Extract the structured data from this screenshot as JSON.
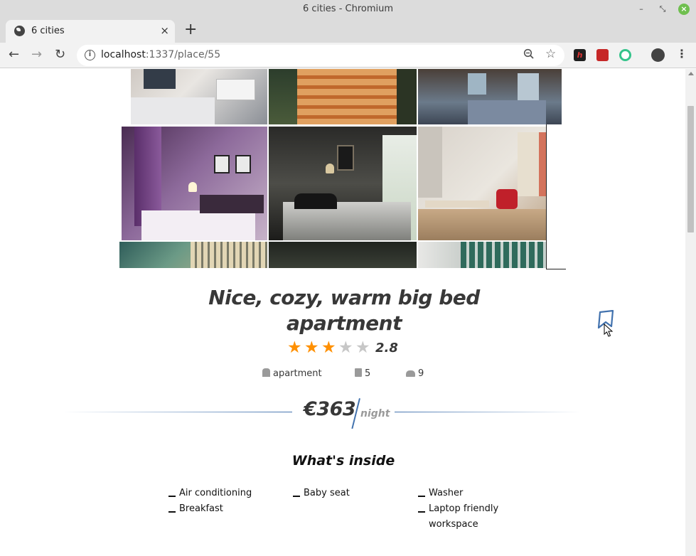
{
  "window": {
    "title": "6 cities - Chromium",
    "controls": {
      "minimize": "–",
      "restore": "⤡",
      "close": "×"
    }
  },
  "tab": {
    "title": "6 cities",
    "close_glyph": "×",
    "new_tab_glyph": "+"
  },
  "toolbar": {
    "back_glyph": "←",
    "forward_glyph": "→",
    "reload_glyph": "↻",
    "info_glyph": "i",
    "url_host": "localhost",
    "url_rest": ":1337/place/55",
    "zoom_icon": "zoom-out-icon",
    "star_glyph": "☆",
    "menu_glyph": "⋮",
    "extension_label": "h"
  },
  "offer": {
    "title_line1": "Nice, cozy, warm big bed",
    "title_line2": "apartment",
    "rating": 2.8,
    "rating_label": "2.8",
    "rating_stars_filled": 3,
    "rating_stars_total": 5,
    "type": "apartment",
    "bedrooms": "5",
    "max_adults": "9",
    "price": "€363",
    "price_unit": "night",
    "bookmarked": false
  },
  "inside": {
    "title": "What's inside",
    "goods_columns": [
      [
        "Air conditioning",
        "Breakfast"
      ],
      [
        "Baby seat"
      ],
      [
        "Washer",
        "Laptop friendly workspace"
      ]
    ]
  },
  "colors": {
    "accent_blue": "#4272ae",
    "star_filled": "#ff9000",
    "star_empty": "#c7c7c7",
    "text": "#383838"
  },
  "gallery": {
    "icon": "photo-gallery",
    "photos_visible": 9
  }
}
